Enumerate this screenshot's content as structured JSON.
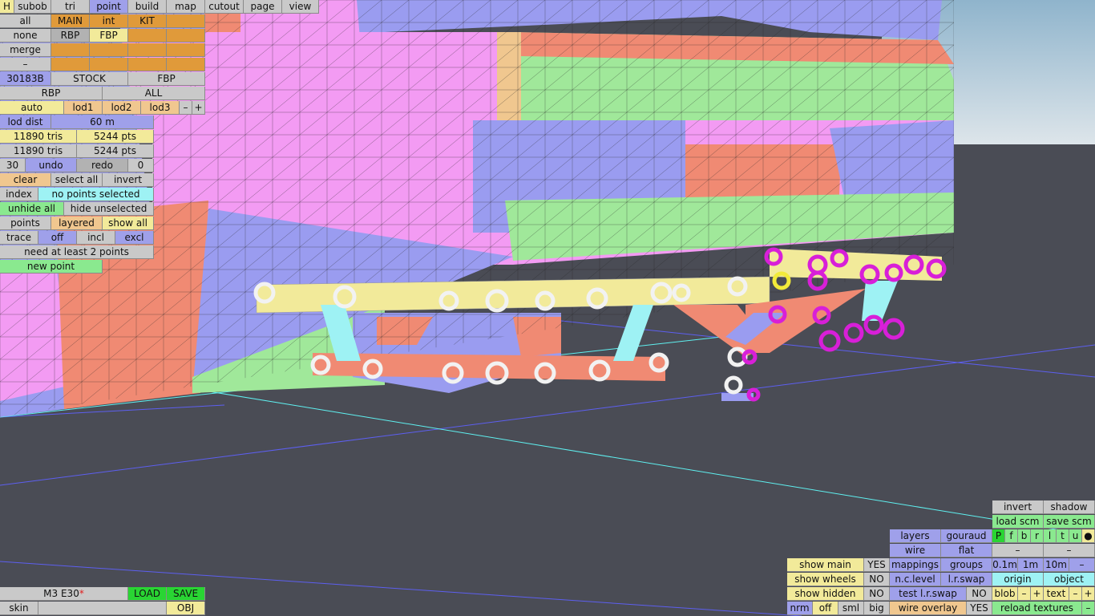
{
  "top_menu": [
    "H",
    "subob",
    "tri",
    "point",
    "build",
    "map",
    "cutout",
    "page",
    "view"
  ],
  "layer_grid": {
    "row1": [
      "all",
      "MAIN",
      "int",
      "KIT",
      ""
    ],
    "row2": [
      "none",
      "RBP",
      "FBP",
      "",
      ""
    ],
    "row3": [
      "merge",
      "",
      "",
      "",
      ""
    ],
    "row4": [
      "–",
      "",
      "",
      "",
      ""
    ]
  },
  "variant_row": [
    "30183B",
    "STOCK",
    "FBP"
  ],
  "part_row": [
    "RBP",
    "ALL"
  ],
  "lod_row": [
    "auto",
    "lod1",
    "lod2",
    "lod3",
    "–",
    "+"
  ],
  "lod_dist": {
    "label": "lod dist",
    "value": "60 m"
  },
  "stats": [
    [
      "11890 tris",
      "5244 pts"
    ],
    [
      "11890 tris",
      "5244 pts"
    ]
  ],
  "undo_row": [
    "30",
    "undo",
    "redo",
    "0"
  ],
  "select_row": [
    "clear",
    "select all",
    "invert"
  ],
  "index_row": {
    "label": "index",
    "value": "no points selected"
  },
  "unhide_row": [
    "unhide all",
    "hide unselected"
  ],
  "points_row": [
    "points",
    "layered",
    "show all"
  ],
  "trace_row": [
    "trace",
    "off",
    "incl",
    "excl"
  ],
  "status_msg": "need at least 2 points",
  "new_point": "new point",
  "bottom_left": {
    "car_name": "M3 E30",
    "modified_mark": "*",
    "load": "LOAD",
    "save": "SAVE",
    "skin": "skin",
    "obj": "OBJ"
  },
  "right_panel": {
    "invert": "invert",
    "shadow": "shadow",
    "load_scm": "load scm",
    "save_scm": "save scm",
    "flags": [
      "P",
      "f",
      "b",
      "r",
      "l",
      "t",
      "u",
      "●"
    ],
    "layers": "layers",
    "gouraud": "gouraud",
    "wire": "wire",
    "flat": "flat",
    "dash": "–",
    "mappings": "mappings",
    "groups": "groups",
    "steps": [
      "0.1m",
      "1m",
      "10m",
      "–"
    ],
    "nc_level": "n.c.level",
    "lr_swap": "l.r.swap",
    "origin": "origin",
    "object": "object",
    "test_lr_swap": "test l.r.swap",
    "no": "NO",
    "blob": "blob",
    "minus": "–",
    "plus": "+",
    "text": "text",
    "show_main": "show main",
    "yes": "YES",
    "show_wheels": "show wheels",
    "show_hidden": "show hidden",
    "nrm": "nrm",
    "off": "off",
    "sml": "sml",
    "big": "big",
    "wire_overlay": "wire overlay",
    "reload_textures": "reload textures"
  },
  "colors": {
    "bg": "#4a4c55",
    "sky": "#c4d4de",
    "body_pink": "#f39bf3",
    "body_green": "#a0e89a",
    "body_blue": "#9a9cf0",
    "body_salmon": "#f08a73",
    "body_yellow": "#f2ea9a",
    "cyan": "#9ef2f4",
    "magenta": "#d81fd8"
  }
}
